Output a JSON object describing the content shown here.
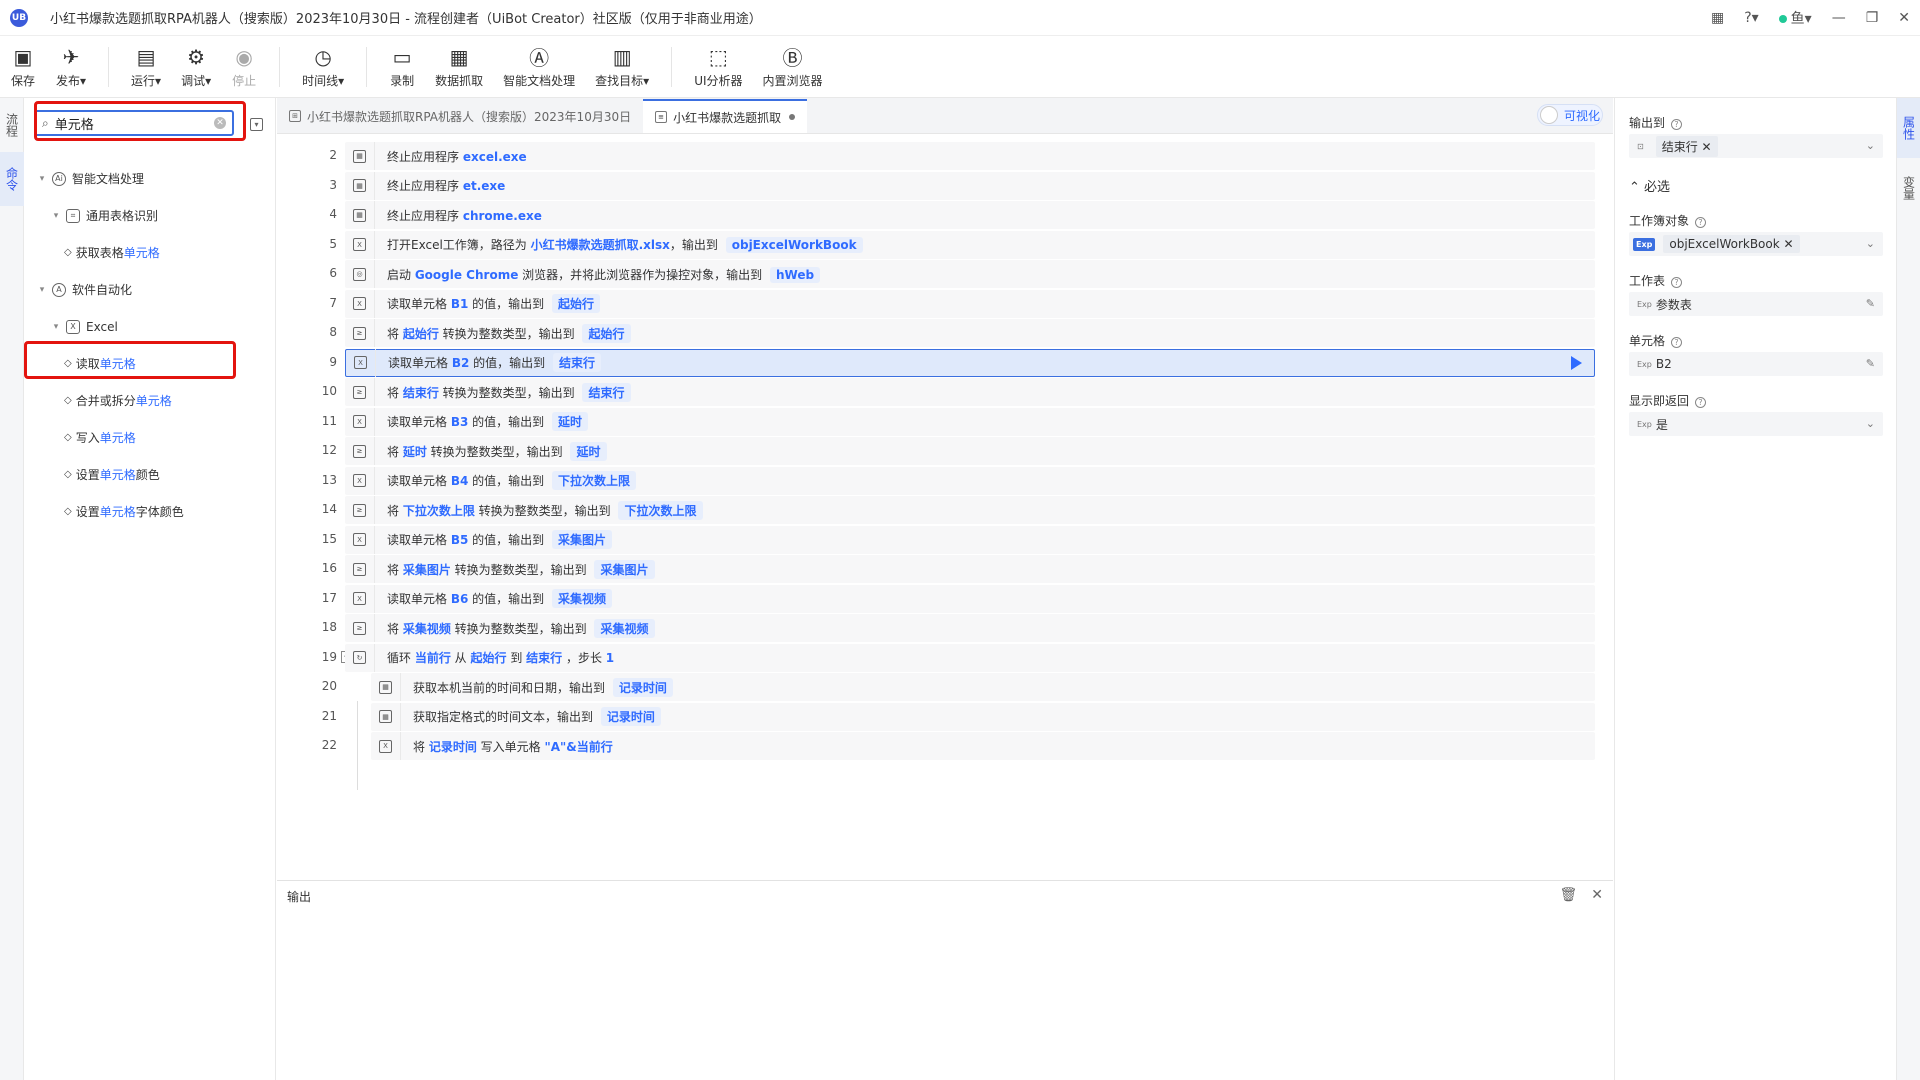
{
  "window": {
    "logo": "UB",
    "title": "小红书爆款选题抓取RPA机器人（搜索版）2023年10月30日 - 流程创建者（UiBot Creator）社区版（仅用于非商业用途）",
    "user": "鱼"
  },
  "toolbar": [
    {
      "label": "保存",
      "icon": "save-icon",
      "glyph": "▣",
      "disabled": false
    },
    {
      "label": "发布▾",
      "icon": "publish-icon",
      "glyph": "✈",
      "disabled": false
    },
    {
      "sep": true
    },
    {
      "label": "运行▾",
      "icon": "run-icon",
      "glyph": "▤",
      "disabled": false
    },
    {
      "label": "调试▾",
      "icon": "debug-icon",
      "glyph": "⚙",
      "disabled": false
    },
    {
      "label": "停止",
      "icon": "stop-icon",
      "glyph": "◉",
      "disabled": true
    },
    {
      "sep": true
    },
    {
      "label": "时间线▾",
      "icon": "timeline-icon",
      "glyph": "◷",
      "disabled": false
    },
    {
      "sep": true
    },
    {
      "label": "录制",
      "icon": "record-icon",
      "glyph": "▭",
      "disabled": false
    },
    {
      "label": "数据抓取",
      "icon": "data-scrape-icon",
      "glyph": "▦",
      "disabled": false
    },
    {
      "label": "智能文档处理",
      "icon": "ai-doc-icon",
      "glyph": "Ⓐ",
      "disabled": false
    },
    {
      "label": "查找目标▾",
      "icon": "find-target-icon",
      "glyph": "▥",
      "disabled": false
    },
    {
      "sep": true
    },
    {
      "label": "UI分析器",
      "icon": "ui-analyzer-icon",
      "glyph": "⬚",
      "disabled": false
    },
    {
      "label": "内置浏览器",
      "icon": "browser-icon",
      "glyph": "Ⓑ",
      "disabled": false
    }
  ],
  "left_tabs": [
    "流程",
    "命令"
  ],
  "search": {
    "value": "单元格",
    "placeholder": "搜索命令"
  },
  "tree": [
    {
      "level": 0,
      "caret": "▾",
      "icon": "Ai",
      "round": true,
      "pre": "智能文档处理",
      "hl": "",
      "post": ""
    },
    {
      "level": 1,
      "caret": "▾",
      "icon": "⌗",
      "round": false,
      "pre": "通用表格识别",
      "hl": "",
      "post": ""
    },
    {
      "level": 2,
      "caret": "",
      "icon": "",
      "pre": "获取表格",
      "hl": "单元格",
      "post": ""
    },
    {
      "level": 0,
      "caret": "▾",
      "icon": "A",
      "round": true,
      "pre": "软件自动化",
      "hl": "",
      "post": ""
    },
    {
      "level": 1,
      "caret": "▾",
      "icon": "X",
      "round": false,
      "pre": "Excel",
      "hl": "",
      "post": ""
    },
    {
      "level": 2,
      "caret": "",
      "icon": "",
      "pre": "读取",
      "hl": "单元格",
      "post": ""
    },
    {
      "level": 2,
      "caret": "",
      "icon": "",
      "pre": "合并或拆分",
      "hl": "单元格",
      "post": ""
    },
    {
      "level": 2,
      "caret": "",
      "icon": "",
      "pre": "写入",
      "hl": "单元格",
      "post": ""
    },
    {
      "level": 2,
      "caret": "",
      "icon": "",
      "pre": "设置",
      "hl": "单元格",
      "post": "颜色"
    },
    {
      "level": 2,
      "caret": "",
      "icon": "",
      "pre": "设置",
      "hl": "单元格",
      "post": "字体颜色"
    }
  ],
  "editor_tabs": [
    {
      "label": "小红书爆款选题抓取RPA机器人（搜索版）2023年10月30日",
      "active": false,
      "dot": false
    },
    {
      "label": "小红书爆款选题抓取",
      "active": true,
      "dot": true
    }
  ],
  "visual_toggle": "可视化",
  "code_rows": [
    {
      "n": "2",
      "indent": 0,
      "icon": "▦",
      "parts": [
        [
          "t",
          "终止应用程序 "
        ],
        [
          "k",
          "excel.exe"
        ]
      ]
    },
    {
      "n": "3",
      "indent": 0,
      "icon": "▦",
      "parts": [
        [
          "t",
          "终止应用程序 "
        ],
        [
          "k",
          "et.exe"
        ]
      ]
    },
    {
      "n": "4",
      "indent": 0,
      "icon": "▦",
      "parts": [
        [
          "t",
          "终止应用程序 "
        ],
        [
          "k",
          "chrome.exe"
        ]
      ]
    },
    {
      "n": "5",
      "indent": 0,
      "icon": "X",
      "parts": [
        [
          "t",
          "打开Excel工作簿，路径为 "
        ],
        [
          "k",
          "小红书爆款选题抓取.xlsx"
        ],
        [
          "t",
          "，输出到 "
        ],
        [
          "g",
          "objExcelWorkBook"
        ]
      ]
    },
    {
      "n": "6",
      "indent": 0,
      "icon": "◎",
      "parts": [
        [
          "t",
          "启动 "
        ],
        [
          "k",
          "Google Chrome"
        ],
        [
          "t",
          " 浏览器，并将此浏览器作为操控对象，输出到 "
        ],
        [
          "g",
          "hWeb"
        ]
      ]
    },
    {
      "n": "7",
      "indent": 0,
      "icon": "X",
      "parts": [
        [
          "t",
          "读取单元格 "
        ],
        [
          "k",
          "B1"
        ],
        [
          "t",
          " 的值，输出到 "
        ],
        [
          "g",
          "起始行"
        ]
      ]
    },
    {
      "n": "8",
      "indent": 0,
      "icon": "≥",
      "parts": [
        [
          "t",
          "将 "
        ],
        [
          "k",
          "起始行"
        ],
        [
          "t",
          " 转换为整数类型，输出到 "
        ],
        [
          "g",
          "起始行"
        ]
      ]
    },
    {
      "n": "9",
      "indent": 0,
      "icon": "X",
      "sel": true,
      "parts": [
        [
          "t",
          "读取单元格 "
        ],
        [
          "k",
          "B2"
        ],
        [
          "t",
          " 的值，输出到 "
        ],
        [
          "g",
          "结束行"
        ]
      ]
    },
    {
      "n": "10",
      "indent": 0,
      "icon": "≥",
      "parts": [
        [
          "t",
          "将 "
        ],
        [
          "k",
          "结束行"
        ],
        [
          "t",
          " 转换为整数类型，输出到 "
        ],
        [
          "g",
          "结束行"
        ]
      ]
    },
    {
      "n": "11",
      "indent": 0,
      "icon": "X",
      "parts": [
        [
          "t",
          "读取单元格 "
        ],
        [
          "k",
          "B3"
        ],
        [
          "t",
          " 的值，输出到 "
        ],
        [
          "g",
          "延时"
        ]
      ]
    },
    {
      "n": "12",
      "indent": 0,
      "icon": "≥",
      "parts": [
        [
          "t",
          "将 "
        ],
        [
          "k",
          "延时"
        ],
        [
          "t",
          " 转换为整数类型，输出到 "
        ],
        [
          "g",
          "延时"
        ]
      ]
    },
    {
      "n": "13",
      "indent": 0,
      "icon": "X",
      "parts": [
        [
          "t",
          "读取单元格 "
        ],
        [
          "k",
          "B4"
        ],
        [
          "t",
          " 的值，输出到 "
        ],
        [
          "g",
          "下拉次数上限"
        ]
      ]
    },
    {
      "n": "14",
      "indent": 0,
      "icon": "≥",
      "parts": [
        [
          "t",
          "将 "
        ],
        [
          "k",
          "下拉次数上限"
        ],
        [
          "t",
          " 转换为整数类型，输出到 "
        ],
        [
          "g",
          "下拉次数上限"
        ]
      ]
    },
    {
      "n": "15",
      "indent": 0,
      "icon": "X",
      "parts": [
        [
          "t",
          "读取单元格 "
        ],
        [
          "k",
          "B5"
        ],
        [
          "t",
          " 的值，输出到 "
        ],
        [
          "g",
          "采集图片"
        ]
      ]
    },
    {
      "n": "16",
      "indent": 0,
      "icon": "≥",
      "parts": [
        [
          "t",
          "将 "
        ],
        [
          "k",
          "采集图片"
        ],
        [
          "t",
          " 转换为整数类型，输出到 "
        ],
        [
          "g",
          "采集图片"
        ]
      ]
    },
    {
      "n": "17",
      "indent": 0,
      "icon": "X",
      "parts": [
        [
          "t",
          "读取单元格 "
        ],
        [
          "k",
          "B6"
        ],
        [
          "t",
          " 的值，输出到 "
        ],
        [
          "g",
          "采集视频"
        ]
      ]
    },
    {
      "n": "18",
      "indent": 0,
      "icon": "≥",
      "parts": [
        [
          "t",
          "将 "
        ],
        [
          "k",
          "采集视频"
        ],
        [
          "t",
          " 转换为整数类型，输出到 "
        ],
        [
          "g",
          "采集视频"
        ]
      ]
    },
    {
      "n": "19",
      "indent": 0,
      "icon": "↻",
      "fold": "−",
      "parts": [
        [
          "t",
          "循环 "
        ],
        [
          "k",
          "当前行"
        ],
        [
          "t",
          " 从 "
        ],
        [
          "k",
          "起始行"
        ],
        [
          "t",
          " 到 "
        ],
        [
          "k",
          "结束行"
        ],
        [
          "t",
          " ，步长 "
        ],
        [
          "k",
          "1"
        ]
      ]
    },
    {
      "n": "20",
      "indent": 1,
      "icon": "▦",
      "parts": [
        [
          "t",
          "获取本机当前的时间和日期，输出到 "
        ],
        [
          "g",
          "记录时间"
        ]
      ]
    },
    {
      "n": "21",
      "indent": 1,
      "icon": "▦",
      "parts": [
        [
          "t",
          "获取指定格式的时间文本，输出到 "
        ],
        [
          "g",
          "记录时间"
        ]
      ]
    },
    {
      "n": "22",
      "indent": 1,
      "icon": "X",
      "parts": [
        [
          "t",
          "将 "
        ],
        [
          "k",
          "记录时间"
        ],
        [
          "t",
          " 写入单元格 "
        ],
        [
          "k",
          "\"A\"&当前行"
        ]
      ]
    }
  ],
  "output": {
    "title": "输出"
  },
  "properties": {
    "output_to": {
      "label": "输出到",
      "value": "结束行"
    },
    "required_title": "必选",
    "workbook": {
      "label": "工作簿对象",
      "exp": "Exp",
      "value": "objExcelWorkBook"
    },
    "sheet": {
      "label": "工作表",
      "exp": "Exp",
      "value": "参数表"
    },
    "cell": {
      "label": "单元格",
      "exp": "Exp",
      "value": "B2"
    },
    "display_return": {
      "label": "显示即返回",
      "exp": "Exp",
      "value": "是"
    }
  },
  "right_tabs": [
    "属性",
    "变量"
  ]
}
